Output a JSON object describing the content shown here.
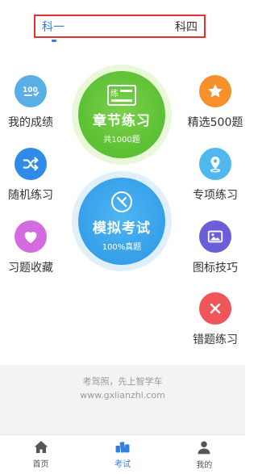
{
  "subject_tabs": {
    "active": "科一",
    "inactive": "科四"
  },
  "left_items": [
    {
      "label": "我的成绩",
      "icon": "score-icon",
      "color": "#5aaee8"
    },
    {
      "label": "随机练习",
      "icon": "shuffle-icon",
      "color": "#2f8ae8"
    },
    {
      "label": "习题收藏",
      "icon": "heart-icon",
      "color": "#d46be0"
    }
  ],
  "right_items": [
    {
      "label": "精选500题",
      "icon": "star-icon",
      "color": "#f5902a"
    },
    {
      "label": "专项练习",
      "icon": "location-icon",
      "color": "#4fb8ee"
    },
    {
      "label": "图标技巧",
      "icon": "image-icon",
      "color": "#6a5fd8"
    },
    {
      "label": "错题练习",
      "icon": "close-icon",
      "color": "#f0555a"
    }
  ],
  "chapter_practice": {
    "title": "章节练习",
    "subtitle": "共1000题",
    "color": "#5cc135"
  },
  "mock_exam": {
    "title": "模拟考试",
    "subtitle": "100%真题",
    "color": "#2f9be8"
  },
  "footer": {
    "slogan": "考驾照，先上智学车",
    "url": "www.gxlianzhi.com"
  },
  "tabbar": {
    "home": "首页",
    "exam": "考试",
    "mine": "我的"
  }
}
